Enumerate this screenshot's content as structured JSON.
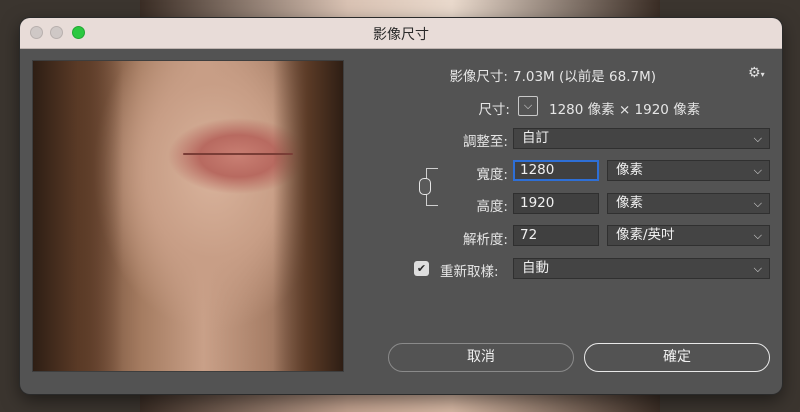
{
  "window": {
    "title": "影像尺寸"
  },
  "info": {
    "image_size_label": "影像尺寸:",
    "image_size_value": "7.03M (以前是 68.7M)",
    "dimensions_label": "尺寸:",
    "dimensions_value": "1280 像素  ×  1920 像素"
  },
  "fit_to": {
    "label": "調整至:",
    "value": "自訂"
  },
  "width": {
    "label": "寬度:",
    "value": "1280",
    "unit": "像素"
  },
  "height": {
    "label": "高度:",
    "value": "1920",
    "unit": "像素"
  },
  "resolution": {
    "label": "解析度:",
    "value": "72",
    "unit": "像素/英吋"
  },
  "resample": {
    "label": "重新取樣:",
    "checked": true,
    "value": "自動"
  },
  "buttons": {
    "cancel": "取消",
    "ok": "確定"
  },
  "icons": {
    "gear": "⚙",
    "chevron": "⌵",
    "check": "✔"
  }
}
